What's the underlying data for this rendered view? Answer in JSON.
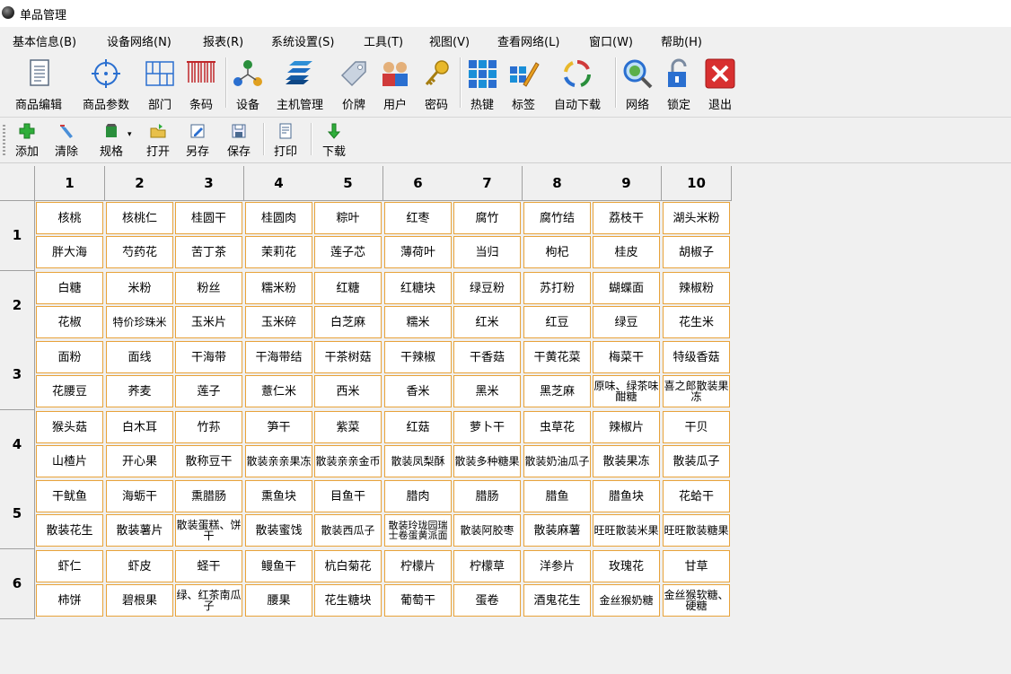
{
  "window": {
    "title": "单品管理"
  },
  "menu": [
    {
      "label": "基本信息(B)"
    },
    {
      "label": "设备网络(N)"
    },
    {
      "label": "报表(R)"
    },
    {
      "label": "系统设置(S)"
    },
    {
      "label": "工具(T)"
    },
    {
      "label": "视图(V)"
    },
    {
      "label": "查看网络(L)"
    },
    {
      "label": "窗口(W)"
    },
    {
      "label": "帮助(H)"
    }
  ],
  "toolbar_main": [
    {
      "label": "商品编辑",
      "icon": "document-icon"
    },
    {
      "label": "商品参数",
      "icon": "crosshair-icon"
    },
    {
      "label": "部门",
      "icon": "grid-icon"
    },
    {
      "label": "条码",
      "icon": "barcode-icon"
    },
    {
      "label": "设备",
      "icon": "network-icon"
    },
    {
      "label": "主机管理",
      "icon": "server-stack-icon"
    },
    {
      "label": "价牌",
      "icon": "price-tag-icon"
    },
    {
      "label": "用户",
      "icon": "users-icon"
    },
    {
      "label": "密码",
      "icon": "key-icon"
    },
    {
      "label": "热键",
      "icon": "hotkey-grid-icon"
    },
    {
      "label": "标签",
      "icon": "label-edit-icon"
    },
    {
      "label": "自动下载",
      "icon": "refresh-cycle-icon"
    },
    {
      "label": "网络",
      "icon": "magnifier-icon"
    },
    {
      "label": "锁定",
      "icon": "lock-icon"
    },
    {
      "label": "退出",
      "icon": "close-icon"
    }
  ],
  "toolbar_secondary": [
    {
      "label": "添加",
      "icon": "plus-icon"
    },
    {
      "label": "清除",
      "icon": "eraser-icon"
    },
    {
      "label": "规格",
      "icon": "format-icon"
    },
    {
      "label": "打开",
      "icon": "open-folder-icon"
    },
    {
      "label": "另存",
      "icon": "save-as-icon"
    },
    {
      "label": "保存",
      "icon": "save-icon"
    },
    {
      "label": "打印",
      "icon": "print-icon"
    },
    {
      "label": "下载",
      "icon": "download-arrow-icon"
    }
  ],
  "grid": {
    "columns": [
      "1",
      "2",
      "3",
      "4",
      "5",
      "6",
      "7",
      "8",
      "9",
      "10"
    ],
    "rows": [
      {
        "label": "1",
        "top": [
          "核桃",
          "核桃仁",
          "桂圆干",
          "桂圆肉",
          "粽叶",
          "红枣",
          "腐竹",
          "腐竹结",
          "荔枝干",
          "湖头米粉"
        ],
        "bottom": [
          "胖大海",
          "芍药花",
          "苦丁茶",
          "茉莉花",
          "莲子芯",
          "薄荷叶",
          "当归",
          "枸杞",
          "桂皮",
          "胡椒子"
        ]
      },
      {
        "label": "2",
        "top": [
          "白糖",
          "米粉",
          "粉丝",
          "糯米粉",
          "红糖",
          "红糖块",
          "绿豆粉",
          "苏打粉",
          "蝴蝶面",
          "辣椒粉"
        ],
        "bottom": [
          "花椒",
          "特价珍珠米",
          "玉米片",
          "玉米碎",
          "白芝麻",
          "糯米",
          "红米",
          "红豆",
          "绿豆",
          "花生米"
        ]
      },
      {
        "label": "3",
        "top": [
          "面粉",
          "面线",
          "干海带",
          "干海带结",
          "干茶树菇",
          "干辣椒",
          "干香菇",
          "干黄花菜",
          "梅菜干",
          "特级香菇"
        ],
        "bottom": [
          "花腰豆",
          "荞麦",
          "莲子",
          "薏仁米",
          "西米",
          "香米",
          "黑米",
          "黑芝麻",
          "原味、绿茶味酣糖",
          "喜之郎散装果冻"
        ]
      },
      {
        "label": "4",
        "top": [
          "猴头菇",
          "白木耳",
          "竹荪",
          "笋干",
          "紫菜",
          "红菇",
          "萝卜干",
          "虫草花",
          "辣椒片",
          "干贝"
        ],
        "bottom": [
          "山楂片",
          "开心果",
          "散称豆干",
          "散装亲亲果冻",
          "散装亲亲金币",
          "散装凤梨酥",
          "散装多种糖果",
          "散装奶油瓜子",
          "散装果冻",
          "散装瓜子"
        ]
      },
      {
        "label": "5",
        "top": [
          "干鱿鱼",
          "海蛎干",
          "熏腊肠",
          "熏鱼块",
          "目鱼干",
          "腊肉",
          "腊肠",
          "腊鱼",
          "腊鱼块",
          "花蛤干"
        ],
        "bottom": [
          "散装花生",
          "散装薯片",
          "散装蛋糕、饼干",
          "散装蜜饯",
          "散装西瓜子",
          "散装玲珑园瑞士卷蛋黄派面",
          "散装阿胶枣",
          "散装麻薯",
          "旺旺散装米果",
          "旺旺散装糖果"
        ]
      },
      {
        "label": "6",
        "top": [
          "虾仁",
          "虾皮",
          "蛏干",
          "鳗鱼干",
          "杭白菊花",
          "柠檬片",
          "柠檬草",
          "洋参片",
          "玫瑰花",
          "甘草"
        ],
        "bottom": [
          "柿饼",
          "碧根果",
          "绿、红茶南瓜子",
          "腰果",
          "花生糖块",
          "葡萄干",
          "蛋卷",
          "酒鬼花生",
          "金丝猴奶糖",
          "金丝猴软糖、硬糖"
        ]
      }
    ]
  }
}
